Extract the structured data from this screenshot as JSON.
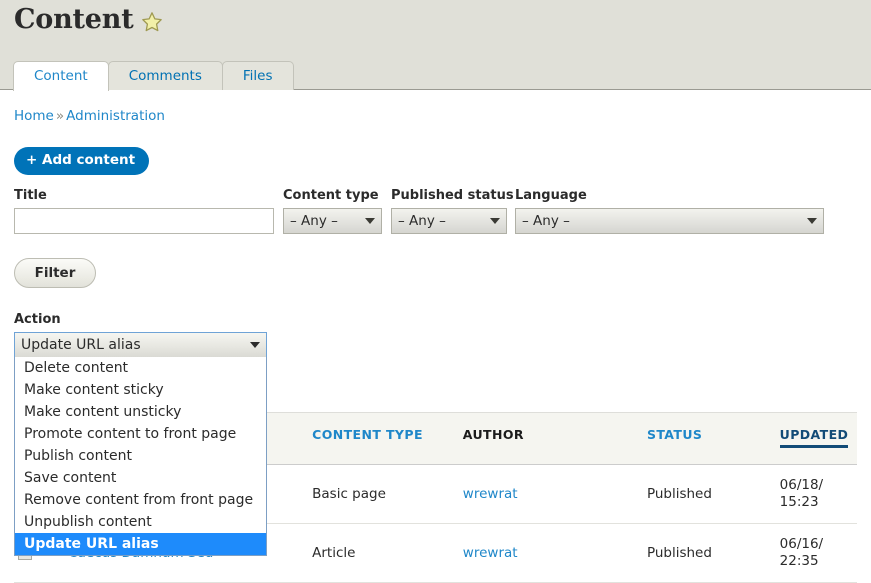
{
  "header": {
    "title": "Content",
    "star_icon": "star-icon"
  },
  "tabs": [
    {
      "label": "Content",
      "active": true
    },
    {
      "label": "Comments",
      "active": false
    },
    {
      "label": "Files",
      "active": false
    }
  ],
  "breadcrumb": {
    "home": "Home",
    "separator": "»",
    "current": "Administration"
  },
  "actions_bar": {
    "add_content_label": "+ Add content"
  },
  "filters": {
    "title": {
      "label": "Title",
      "value": "",
      "placeholder": ""
    },
    "content_type": {
      "label": "Content type",
      "value": "– Any –"
    },
    "published_status": {
      "label": "Published status",
      "value": "– Any –"
    },
    "language": {
      "label": "Language",
      "value": "– Any –"
    },
    "filter_button": "Filter"
  },
  "action": {
    "label": "Action",
    "selected": "Update URL alias",
    "options": [
      {
        "label": "Delete content",
        "selected": false
      },
      {
        "label": "Make content sticky",
        "selected": false
      },
      {
        "label": "Make content unsticky",
        "selected": false
      },
      {
        "label": "Promote content to front page",
        "selected": false
      },
      {
        "label": "Publish content",
        "selected": false
      },
      {
        "label": "Save content",
        "selected": false
      },
      {
        "label": "Remove content from front page",
        "selected": false
      },
      {
        "label": "Unpublish content",
        "selected": false
      },
      {
        "label": "Update URL alias",
        "selected": true
      }
    ]
  },
  "table": {
    "columns": [
      {
        "label": "",
        "kind": "checkbox"
      },
      {
        "label": "",
        "kind": "plain"
      },
      {
        "label": "CONTENT TYPE",
        "kind": "link"
      },
      {
        "label": "AUTHOR",
        "kind": "plain"
      },
      {
        "label": "STATUS",
        "kind": "link"
      },
      {
        "label": "UPDATED",
        "kind": "active-sort"
      }
    ],
    "rows": [
      {
        "title": "",
        "content_type": "Basic page",
        "author": "wrewrat",
        "status": "Published",
        "updated_date": "06/18/",
        "updated_time": "15:23"
      },
      {
        "title": "Caecus Damnum Sed",
        "content_type": "Article",
        "author": "wrewrat",
        "status": "Published",
        "updated_date": "06/16/",
        "updated_time": "22:35"
      }
    ]
  },
  "colors": {
    "link": "#1f87c9",
    "primary_button": "#0073b8",
    "header_band": "#e0e0d8",
    "selected_option": "#1e8bfb",
    "active_sort": "#124b77"
  }
}
